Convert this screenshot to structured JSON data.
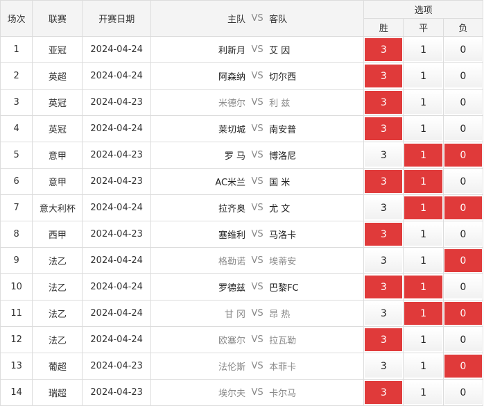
{
  "header": {
    "match": "场次",
    "league": "联赛",
    "date": "开赛日期",
    "home": "主队",
    "vs": "VS",
    "away": "客队",
    "options": "选项",
    "win": "胜",
    "draw": "平",
    "lose": "负"
  },
  "colors": {
    "selected": "#e03a3a",
    "border": "#dcdcdc",
    "header_bg": "#f4f4f4"
  },
  "rows": [
    {
      "no": "1",
      "league": "亚冠",
      "date": "2024-04-24",
      "home": "利新月",
      "away": "艾 因",
      "teams_style": "strong",
      "win": "3",
      "draw": "1",
      "lose": "0",
      "sel": [
        true,
        false,
        false
      ]
    },
    {
      "no": "2",
      "league": "英超",
      "date": "2024-04-24",
      "home": "阿森纳",
      "away": "切尔西",
      "teams_style": "strong",
      "win": "3",
      "draw": "1",
      "lose": "0",
      "sel": [
        true,
        false,
        false
      ]
    },
    {
      "no": "3",
      "league": "英冠",
      "date": "2024-04-23",
      "home": "米德尔",
      "away": "利 兹",
      "teams_style": "muted",
      "win": "3",
      "draw": "1",
      "lose": "0",
      "sel": [
        true,
        false,
        false
      ]
    },
    {
      "no": "4",
      "league": "英冠",
      "date": "2024-04-24",
      "home": "莱切城",
      "away": "南安普",
      "teams_style": "strong",
      "win": "3",
      "draw": "1",
      "lose": "0",
      "sel": [
        true,
        false,
        false
      ]
    },
    {
      "no": "5",
      "league": "意甲",
      "date": "2024-04-23",
      "home": "罗 马",
      "away": "博洛尼",
      "teams_style": "strong",
      "win": "3",
      "draw": "1",
      "lose": "0",
      "sel": [
        false,
        true,
        true
      ]
    },
    {
      "no": "6",
      "league": "意甲",
      "date": "2024-04-23",
      "home": "AC米兰",
      "away": "国 米",
      "teams_style": "strong",
      "win": "3",
      "draw": "1",
      "lose": "0",
      "sel": [
        true,
        true,
        false
      ]
    },
    {
      "no": "7",
      "league": "意大利杯",
      "date": "2024-04-24",
      "home": "拉齐奥",
      "away": "尤 文",
      "teams_style": "strong",
      "win": "3",
      "draw": "1",
      "lose": "0",
      "sel": [
        false,
        true,
        true
      ]
    },
    {
      "no": "8",
      "league": "西甲",
      "date": "2024-04-23",
      "home": "塞维利",
      "away": "马洛卡",
      "teams_style": "strong",
      "win": "3",
      "draw": "1",
      "lose": "0",
      "sel": [
        true,
        false,
        false
      ]
    },
    {
      "no": "9",
      "league": "法乙",
      "date": "2024-04-24",
      "home": "格勒诺",
      "away": "埃蒂安",
      "teams_style": "muted",
      "win": "3",
      "draw": "1",
      "lose": "0",
      "sel": [
        false,
        false,
        true
      ]
    },
    {
      "no": "10",
      "league": "法乙",
      "date": "2024-04-24",
      "home": "罗德兹",
      "away": "巴黎FC",
      "teams_style": "strong",
      "win": "3",
      "draw": "1",
      "lose": "0",
      "sel": [
        true,
        true,
        false
      ]
    },
    {
      "no": "11",
      "league": "法乙",
      "date": "2024-04-24",
      "home": "甘 冈",
      "away": "昂 热",
      "teams_style": "muted",
      "win": "3",
      "draw": "1",
      "lose": "0",
      "sel": [
        false,
        true,
        true
      ]
    },
    {
      "no": "12",
      "league": "法乙",
      "date": "2024-04-24",
      "home": "欧塞尔",
      "away": "拉瓦勒",
      "teams_style": "muted",
      "win": "3",
      "draw": "1",
      "lose": "0",
      "sel": [
        true,
        false,
        false
      ]
    },
    {
      "no": "13",
      "league": "葡超",
      "date": "2024-04-23",
      "home": "法伦斯",
      "away": "本菲卡",
      "teams_style": "muted",
      "win": "3",
      "draw": "1",
      "lose": "0",
      "sel": [
        false,
        false,
        true
      ]
    },
    {
      "no": "14",
      "league": "瑞超",
      "date": "2024-04-23",
      "home": "埃尔夫",
      "away": "卡尔马",
      "teams_style": "muted",
      "win": "3",
      "draw": "1",
      "lose": "0",
      "sel": [
        true,
        false,
        false
      ]
    }
  ]
}
